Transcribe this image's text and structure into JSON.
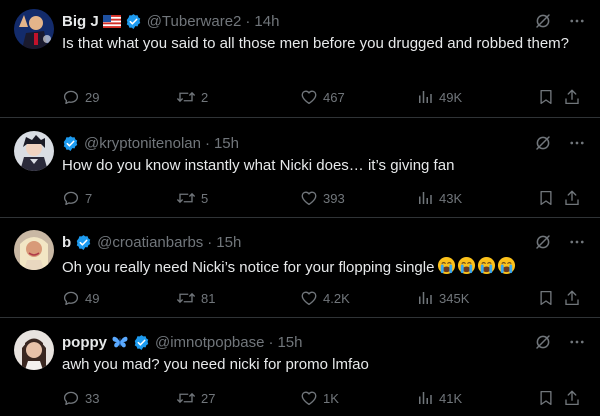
{
  "posts": [
    {
      "name": "Big J",
      "has_flag": true,
      "handle": "@Tuberware2",
      "time": "14h",
      "text": "Is that what you said to all those men before you drugged and robbed them?",
      "replies": "29",
      "reposts": "2",
      "likes": "467",
      "views": "49K"
    },
    {
      "name": "",
      "handle": "@kryptonitenolan",
      "time": "15h",
      "text": "How do you know instantly what Nicki does… it’s giving fan",
      "replies": "7",
      "reposts": "5",
      "likes": "393",
      "views": "43K"
    },
    {
      "name": "b",
      "handle": "@croatianbarbs",
      "time": "15h",
      "text": "Oh you really need Nicki’s notice for your flopping single",
      "emoji": "crying-face-emoji",
      "replies": "49",
      "reposts": "81",
      "likes": "4.2K",
      "views": "345K"
    },
    {
      "name": "poppy",
      "handle": "@imnotpopbase",
      "time": "15h",
      "text": "awh you mad? you need nicki for promo lmfao",
      "replies": "33",
      "reposts": "27",
      "likes": "1K",
      "views": "41K"
    }
  ],
  "colors": {
    "background": "#000000",
    "text": "#e7e9ea",
    "muted": "#71767b",
    "verified": "#1d9bf0",
    "divider": "#2f3336"
  },
  "icons": [
    "reply-icon",
    "repost-icon",
    "like-icon",
    "views-icon",
    "bookmark-icon",
    "share-icon",
    "grok-icon",
    "more-icon",
    "verified-icon",
    "us-flag-icon",
    "butterfly-icon"
  ]
}
